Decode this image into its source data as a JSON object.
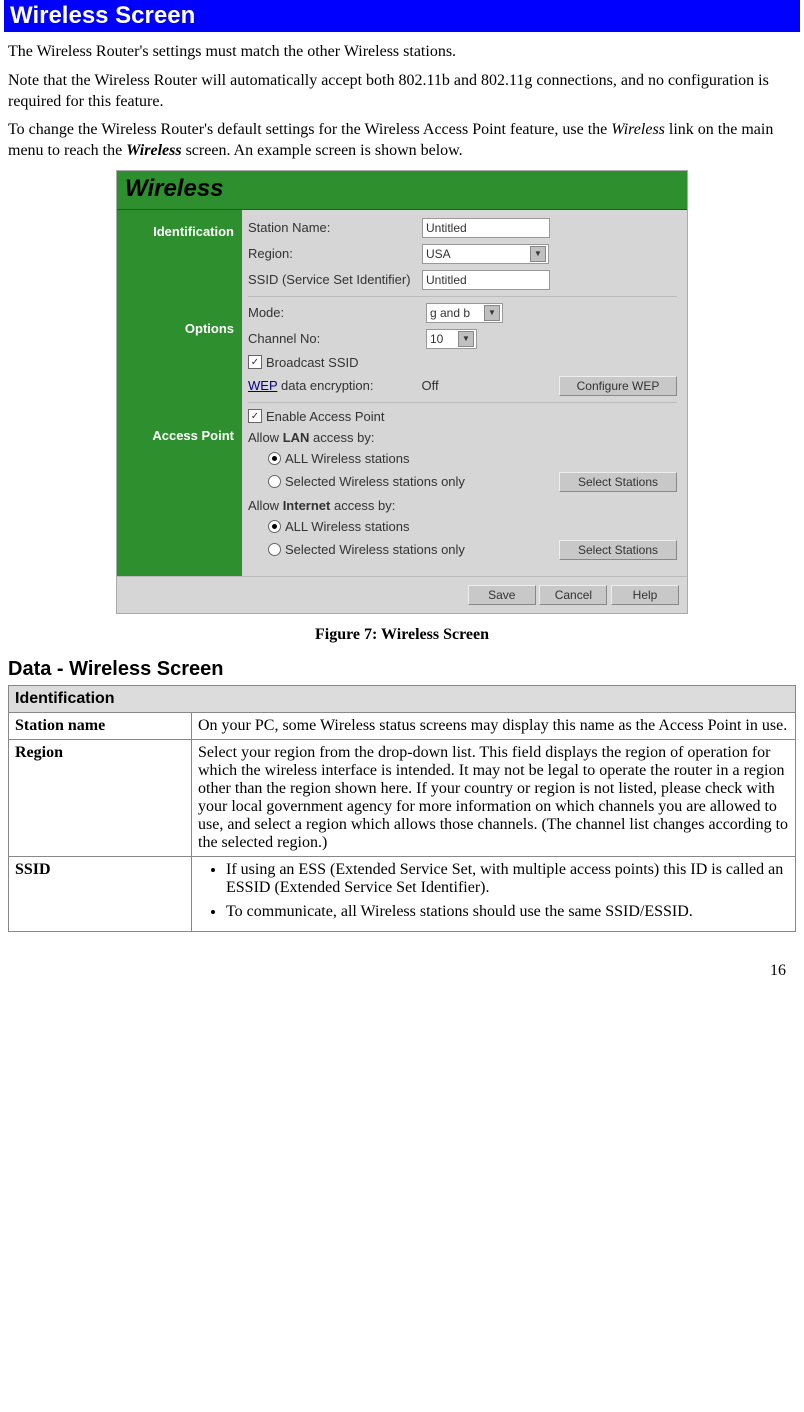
{
  "header": {
    "title": "Wireless Screen"
  },
  "intro": {
    "p1": "The Wireless Router's settings must match the other Wireless stations.",
    "p2": "Note that the Wireless Router will automatically accept both 802.11b and 802.11g connections, and no configuration is required for this feature.",
    "p3_pre": "To change the Wireless Router's default settings for the Wireless Access Point feature, use the ",
    "p3_em1": "Wireless",
    "p3_mid": " link on the main menu to reach the ",
    "p3_em2": "Wireless",
    "p3_post": " screen. An example screen is shown below."
  },
  "figure": {
    "caption": "Figure 7: Wireless Screen",
    "title": "Wireless",
    "sections": {
      "identification": "Identification",
      "options": "Options",
      "access_point": "Access Point"
    },
    "fields": {
      "station_name_label": "Station Name:",
      "station_name_value": "Untitled",
      "region_label": "Region:",
      "region_value": "USA",
      "ssid_label": "SSID (Service Set Identifier)",
      "ssid_value": "Untitled",
      "mode_label": "Mode:",
      "mode_value": "g and b",
      "channel_label": "Channel No:",
      "channel_value": "10",
      "broadcast_ssid": "Broadcast SSID",
      "wep_link": "WEP",
      "wep_rest": " data encryption:",
      "wep_status": "Off",
      "configure_wep": "Configure WEP",
      "enable_ap": "Enable Access Point",
      "allow_lan_pre": "Allow ",
      "allow_lan_bold": "LAN",
      "allow_lan_post": " access by:",
      "opt_all": "ALL Wireless stations",
      "opt_selected": "Selected Wireless stations only",
      "select_stations": "Select Stations",
      "allow_internet_pre": "Allow ",
      "allow_internet_bold": "Internet",
      "allow_internet_post": " access by:",
      "save": "Save",
      "cancel": "Cancel",
      "help": "Help"
    }
  },
  "data_section": {
    "heading": "Data - Wireless Screen",
    "sub_header": "Identification",
    "rows": {
      "station": {
        "label": "Station name",
        "desc": "On your PC, some Wireless status screens may display this name as the Access Point in use."
      },
      "region": {
        "label": "Region",
        "desc": "Select your region from the drop-down list. This field displays the region of operation for which the wireless interface is intended. It may not be legal to operate the router in a region other than the region shown here. If your country or region is not listed, please check with your local government agency for more information on which channels you are allowed to use, and select a region which allows those channels. (The channel list changes according to the selected region.)"
      },
      "ssid": {
        "label": "SSID",
        "b1": "If using an ESS (Extended Service Set, with multiple access points) this ID is called an ESSID (Extended Service Set Identifier).",
        "b2": "To communicate, all Wireless stations should use the same SSID/ESSID."
      }
    }
  },
  "page_number": "16"
}
